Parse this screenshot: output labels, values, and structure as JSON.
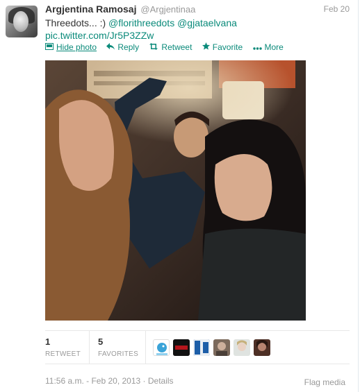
{
  "tweet": {
    "fullname": "Argjentina Ramosaj",
    "screen_name": "@Argjentinaa",
    "date": "Feb 20",
    "text_plain": "Threedots... :) ",
    "mention_1": "@florithreedots",
    "mention_2": "@gjataelvana",
    "pic_link": "pic.twitter.com/Jr5P3ZZw"
  },
  "actions": {
    "hide_photo": "Hide photo",
    "reply": "Reply",
    "retweet": "Retweet",
    "favorite": "Favorite",
    "more": "More"
  },
  "stats": {
    "retweets_count": "1",
    "retweets_label": "RETWEET",
    "favorites_count": "5",
    "favorites_label": "FAVORITES"
  },
  "favorited_by": [
    {
      "icon": "avatar-blue-bird"
    },
    {
      "icon": "avatar-dark-logo"
    },
    {
      "icon": "avatar-blue-white"
    },
    {
      "icon": "avatar-person-1"
    },
    {
      "icon": "avatar-person-2"
    },
    {
      "icon": "avatar-person-3"
    }
  ],
  "footer": {
    "timestamp": "11:56 a.m. - Feb 20, 2013",
    "separator": " · ",
    "details": "Details",
    "flag_media": "Flag media"
  },
  "colors": {
    "link": "#0a8a7a",
    "muted": "#999999",
    "text": "#333333"
  }
}
